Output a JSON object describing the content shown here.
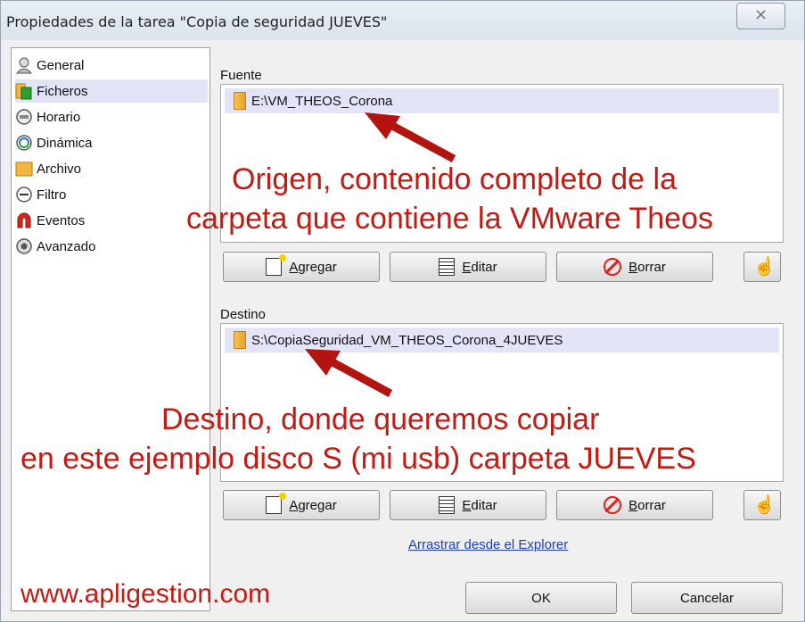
{
  "window": {
    "title": "Propiedades de la tarea \"Copia de seguridad JUEVES\"",
    "close_glyph": "⨯"
  },
  "sidebar": {
    "items": [
      {
        "label": "General",
        "icon": "user-icon"
      },
      {
        "label": "Ficheros",
        "icon": "files-icon",
        "selected": true
      },
      {
        "label": "Horario",
        "icon": "clock-icon"
      },
      {
        "label": "Dinámica",
        "icon": "refresh-icon"
      },
      {
        "label": "Archivo",
        "icon": "archive-icon"
      },
      {
        "label": "Filtro",
        "icon": "filter-icon"
      },
      {
        "label": "Eventos",
        "icon": "magnet-icon"
      },
      {
        "label": "Avanzado",
        "icon": "gear-icon"
      }
    ]
  },
  "fuente": {
    "label": "Fuente",
    "items": [
      "E:\\VM_THEOS_Corona"
    ]
  },
  "destino": {
    "label": "Destino",
    "items": [
      "S:\\CopiaSeguridad_VM_THEOS_Corona_4JUEVES"
    ]
  },
  "buttons": {
    "add_first": "A",
    "add_rest": "gregar",
    "edit_first": "E",
    "edit_rest": "ditar",
    "delete_first": "B",
    "delete_rest": "orrar",
    "ok": "OK",
    "cancel": "Cancelar"
  },
  "drag_link": "Arrastrar desde el Explorer",
  "annotations": {
    "origin_line1": "Origen, contenido completo de la",
    "origin_line2": "carpeta que contiene la VMware Theos",
    "dest_line1": "Destino, donde queremos copiar",
    "dest_line2": "en este ejemplo disco S (mi usb) carpeta JUEVES",
    "website": "www.apligestion.com"
  },
  "colors": {
    "annotation_red": "#c41a14",
    "selection": "#e3e4f8",
    "link_blue": "#1a3ec0"
  }
}
